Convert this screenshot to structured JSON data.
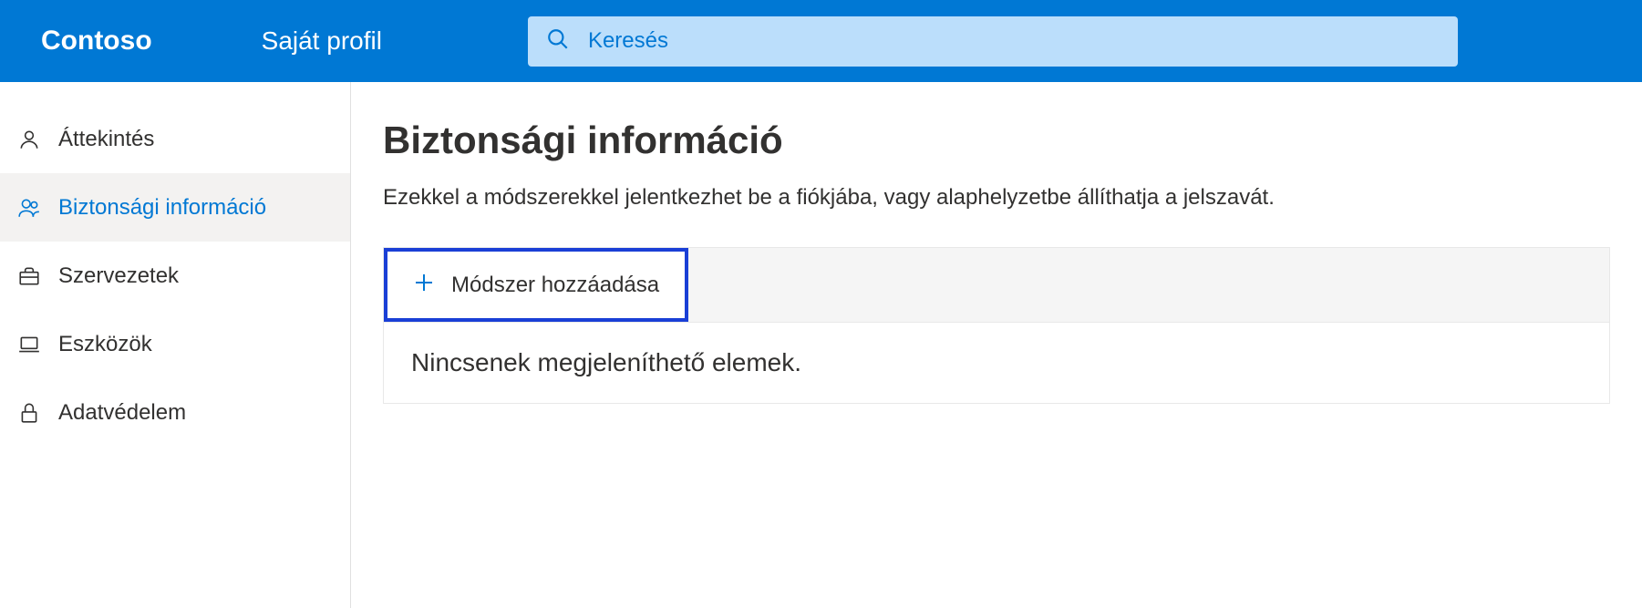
{
  "header": {
    "brand": "Contoso",
    "page_name": "Saját profil",
    "search_placeholder": "Keresés"
  },
  "sidebar": {
    "items": [
      {
        "label": "Áttekintés",
        "icon": "person-icon",
        "active": false
      },
      {
        "label": "Biztonsági információ",
        "icon": "people-icon",
        "active": true
      },
      {
        "label": "Szervezetek",
        "icon": "briefcase-icon",
        "active": false
      },
      {
        "label": "Eszközök",
        "icon": "laptop-icon",
        "active": false
      },
      {
        "label": "Adatvédelem",
        "icon": "lock-icon",
        "active": false
      }
    ]
  },
  "main": {
    "title": "Biztonsági információ",
    "subtitle": "Ezekkel a módszerekkel jelentkezhet be a fiókjába, vagy alaphelyzetbe állíthatja a jelszavát.",
    "add_method_label": "Módszer hozzáadása",
    "empty_text": "Nincsenek megjeleníthető elemek."
  },
  "colors": {
    "primary": "#0078d4",
    "highlight_border": "#1a3fd6",
    "search_bg": "#bbdefb"
  }
}
